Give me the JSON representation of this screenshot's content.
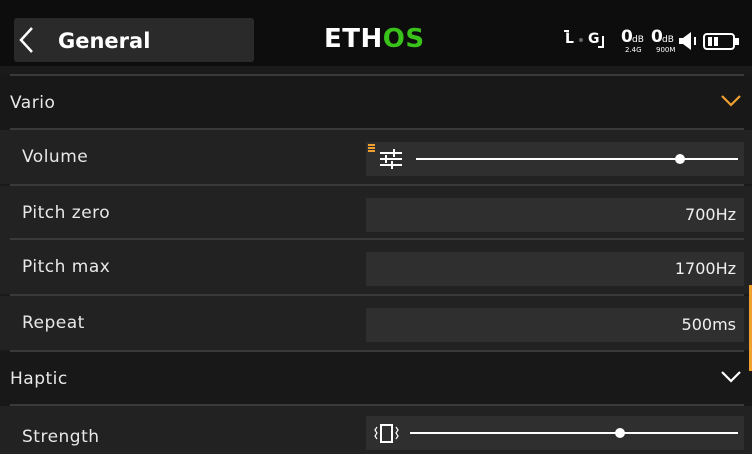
{
  "header": {
    "title": "General",
    "logo": {
      "part1": "ETH",
      "part2": "OS"
    },
    "status": {
      "rx_label": "L",
      "gyro_label": "G",
      "rssi1_value": "0",
      "rssi1_unit": "dB",
      "rssi1_band": "2.4G",
      "rssi2_value": "0",
      "rssi2_unit": "dB",
      "rssi2_band": "900M"
    }
  },
  "sections": {
    "vario": {
      "label": "Vario",
      "expanded": true,
      "items": {
        "volume": {
          "label": "Volume",
          "slider_level": 0.82
        },
        "pitch_zero": {
          "label": "Pitch zero",
          "value": "700Hz"
        },
        "pitch_max": {
          "label": "Pitch max",
          "value": "1700Hz"
        },
        "repeat": {
          "label": "Repeat",
          "value": "500ms"
        }
      }
    },
    "haptic": {
      "label": "Haptic",
      "expanded": false,
      "items": {
        "strength": {
          "label": "Strength",
          "slider_level": 0.64
        }
      }
    }
  },
  "colors": {
    "accent": "#f0a030",
    "logo_green": "#39c21a",
    "background": "#1a1a1a"
  },
  "icons": [
    "back-chevron-icon",
    "link-icon",
    "gyro-icon",
    "speaker-icon",
    "battery-icon",
    "chevron-down-icon",
    "mixer-sliders-icon",
    "vibration-icon"
  ]
}
